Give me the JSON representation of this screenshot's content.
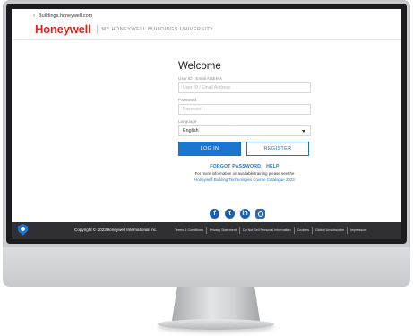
{
  "browser": {
    "back_link": "Buildings.honeywell.com"
  },
  "header": {
    "logo": "Honeywell",
    "university": "MY HONEYWELL BUILDINGS UNIVERSITY"
  },
  "login": {
    "title": "Welcome",
    "user_label": "User ID / Email Address",
    "user_placeholder": "User ID / Email Address",
    "password_label": "Password",
    "password_placeholder": "Password",
    "language_label": "Language",
    "language_value": "English",
    "login_button": "LOG IN",
    "register_button": "REGISTER",
    "forgot_password": "FORGOT PASSWORD",
    "help": "HELP",
    "info_line": "For more information on available training please see the",
    "catalogue_link": "Honeywell Building Technologies Course Catalogue 2023"
  },
  "socials": [
    {
      "icon": "facebook-icon",
      "glyph": "f"
    },
    {
      "icon": "twitter-icon",
      "glyph": "t"
    },
    {
      "icon": "linkedin-icon",
      "glyph": "in"
    },
    {
      "icon": "instagram-icon",
      "glyph": ""
    }
  ],
  "footer": {
    "copyright": "Copyright © 2023Honeywell International Inc.",
    "links": [
      "Terms & Conditions",
      "Privacy Statement",
      "Do Not Sell Personal Information",
      "Cookies",
      "Global Unsubscribe",
      "Impressum"
    ]
  },
  "colors": {
    "brand_red": "#e1251b",
    "accent_blue": "#1b75d0",
    "footer_bg": "#2f2f34"
  }
}
